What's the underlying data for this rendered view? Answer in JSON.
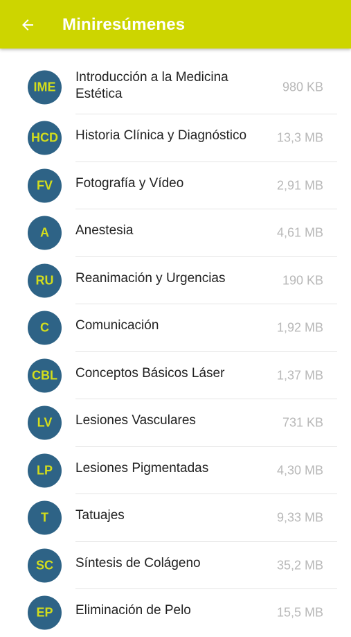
{
  "appbar": {
    "title": "Miniresúmenes",
    "back_icon": "arrow-left-icon",
    "color": "#cdd500"
  },
  "avatar_colors": {
    "background": "#2e6386",
    "text": "#d3dd1c"
  },
  "items": [
    {
      "initials": "IME",
      "title": "Introducción a la Medicina Estética",
      "size": "980 KB"
    },
    {
      "initials": "HCD",
      "title": "Historia Clínica y Diagnóstico",
      "size": "13,3 MB"
    },
    {
      "initials": "FV",
      "title": "Fotografía y Vídeo",
      "size": "2,91 MB"
    },
    {
      "initials": "A",
      "title": "Anestesia",
      "size": "4,61 MB"
    },
    {
      "initials": "RU",
      "title": "Reanimación y Urgencias",
      "size": "190 KB"
    },
    {
      "initials": "C",
      "title": "Comunicación",
      "size": "1,92 MB"
    },
    {
      "initials": "CBL",
      "title": "Conceptos Básicos Láser",
      "size": "1,37 MB"
    },
    {
      "initials": "LV",
      "title": "Lesiones Vasculares",
      "size": "731 KB"
    },
    {
      "initials": "LP",
      "title": "Lesiones Pigmentadas",
      "size": "4,30 MB"
    },
    {
      "initials": "T",
      "title": "Tatuajes",
      "size": "9,33 MB"
    },
    {
      "initials": "SC",
      "title": "Síntesis de Colágeno",
      "size": "35,2 MB"
    },
    {
      "initials": "EP",
      "title": "Eliminación de Pelo",
      "size": "15,5 MB"
    }
  ]
}
